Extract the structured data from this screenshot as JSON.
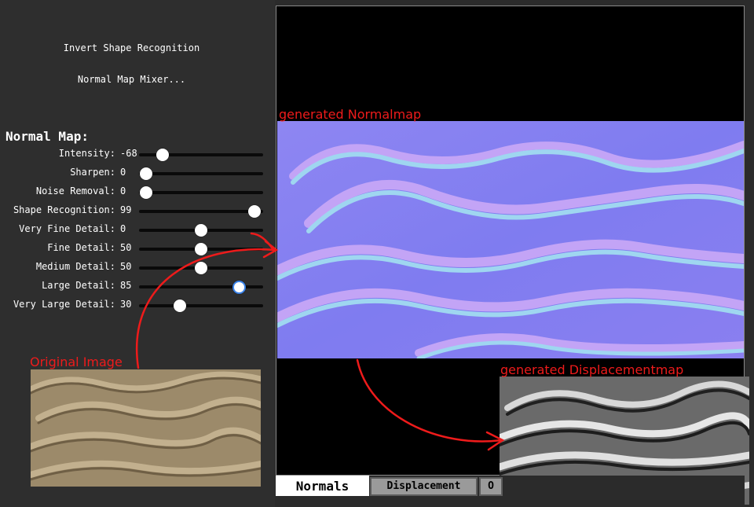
{
  "buttons": {
    "invert_shape": "Invert Shape Recognition",
    "normal_map_mixer": "Normal Map Mixer..."
  },
  "section_title": "Normal Map:",
  "sliders": [
    {
      "label": "Intensity:",
      "value": "-68",
      "fraction": 0.19
    },
    {
      "label": "Sharpen:",
      "value": "0",
      "fraction": 0.06
    },
    {
      "label": "Noise Removal:",
      "value": "0",
      "fraction": 0.06
    },
    {
      "label": "Shape Recognition:",
      "value": "99",
      "fraction": 0.93
    },
    {
      "label": "Very Fine Detail:",
      "value": "0",
      "fraction": 0.5
    },
    {
      "label": "Fine Detail:",
      "value": "50",
      "fraction": 0.5
    },
    {
      "label": "Medium Detail:",
      "value": "50",
      "fraction": 0.5
    },
    {
      "label": "Large Detail:",
      "value": "85",
      "fraction": 0.81
    },
    {
      "label": "Very Large Detail:",
      "value": "30",
      "fraction": 0.33
    }
  ],
  "tabs": [
    {
      "label": "Normals",
      "selected": true
    },
    {
      "label": "Displacement",
      "selected": false
    },
    {
      "label": "O",
      "selected": false
    }
  ],
  "captions": {
    "normalmap": "generated Normalmap",
    "original": "Original Image",
    "displacement": "generated Displacementmap"
  },
  "colors": {
    "annotation": "#ee1b1b",
    "panel_bg": "#2e2e2e",
    "viewer_bg": "#000000",
    "thumb_active_ring": "#3b83e8"
  }
}
